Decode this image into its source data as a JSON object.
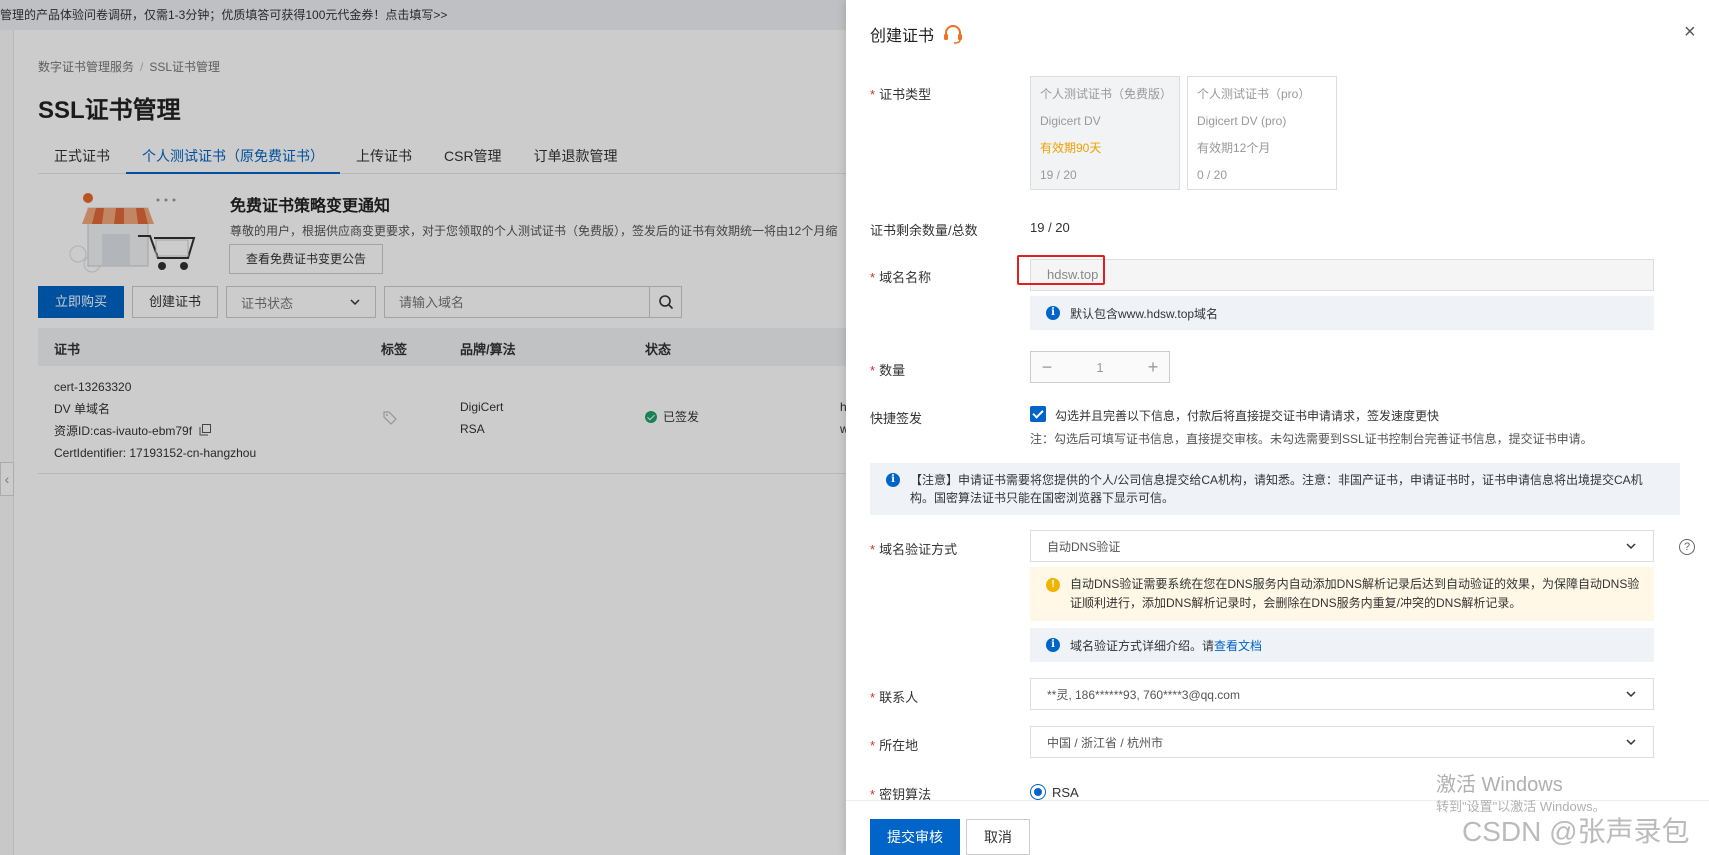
{
  "survey_bar": "管理的产品体验问卷调研，仅需1-3分钟；优质填答可获得100元代金券！点击填写>>",
  "breadcrumb": [
    "数字证书管理服务",
    "SSL证书管理"
  ],
  "page_title": "SSL证书管理",
  "tabs": [
    "正式证书",
    "个人测试证书（原免费证书）",
    "上传证书",
    "CSR管理",
    "订单退款管理"
  ],
  "notice": {
    "title": "免费证书策略变更通知",
    "text": "尊敬的用户，根据供应商变更要求，对于您领取的个人测试证书（免费版），签发后的证书有效期统一将由12个月缩",
    "button": "查看免费证书变更公告"
  },
  "toolbar": {
    "buy": "立即购买",
    "create": "创建证书",
    "status_select": "证书状态",
    "search_placeholder": "请输入域名"
  },
  "table": {
    "headers": [
      "证书",
      "标签",
      "品牌/算法",
      "状态"
    ],
    "row": {
      "name": "cert-13263320",
      "type": "DV 单域名",
      "resource": "资源ID:cas-ivauto-ebm79f",
      "identifier": "CertIdentifier: 17193152-cn-hangzhou",
      "brand": "DigiCert",
      "algo": "RSA",
      "status": "已签发",
      "extra1": "h",
      "extra2": "w"
    }
  },
  "drawer": {
    "title": "创建证书",
    "fields": {
      "cert_type": "证书类型",
      "remaining": "证书剩余数量/总数",
      "domain": "域名名称",
      "quantity": "数量",
      "quick_issue": "快捷签发",
      "verify_method": "域名验证方式",
      "contact": "联系人",
      "location": "所在地",
      "key_algo": "密钥算法"
    },
    "cards": [
      {
        "name": "个人测试证书（免费版）",
        "brand": "Digicert DV",
        "validity": "有效期90天",
        "count": "19 / 20"
      },
      {
        "name": "个人测试证书（pro）",
        "brand": "Digicert DV (pro)",
        "validity": "有效期12个月",
        "count": "0 / 20"
      }
    ],
    "remaining_value": "19 / 20",
    "domain_value": "hdsw.top",
    "domain_hint": "默认包含www.hdsw.top域名",
    "quantity_value": "1",
    "quick_issue_label": "勾选并且完善以下信息，付款后将直接提交证书申请请求，签发速度更快",
    "quick_issue_note": "注：勾选后可填写证书信息，直接提交审核。未勾选需要到SSL证书控制台完善证书信息，提交证书申请。",
    "notice": "【注意】申请证书需要将您提供的个人/公司信息提交给CA机构，请知悉。注意：非国产证书，申请证书时，证书申请信息将出境提交CA机构。国密算法证书只能在国密浏览器下显示可信。",
    "verify_value": "自动DNS验证",
    "verify_warning": "自动DNS验证需要系统在您在DNS服务内自动添加DNS解析记录后达到自动验证的效果，为保障自动DNS验证顺利进行，添加DNS解析记录时，会删除在DNS服务内重复/冲突的DNS解析记录。",
    "verify_doc_prefix": "域名验证方式详细介绍。请",
    "verify_doc_link": "查看文档",
    "contact_value": "**灵, 186******93, 760****3@qq.com",
    "location_value": "中国 / 浙江省 / 杭州市",
    "key_algo_value": "RSA",
    "submit": "提交审核",
    "cancel": "取消"
  },
  "watermarks": {
    "activate_1": "激活 Windows",
    "activate_2": "转到\"设置\"以激活 Windows。",
    "csdn": "CSDN @张声录包"
  },
  "colors": {
    "primary": "#0064c8",
    "required": "#d93026",
    "highlight_box": "#e02020",
    "validity": "#f0a000"
  }
}
